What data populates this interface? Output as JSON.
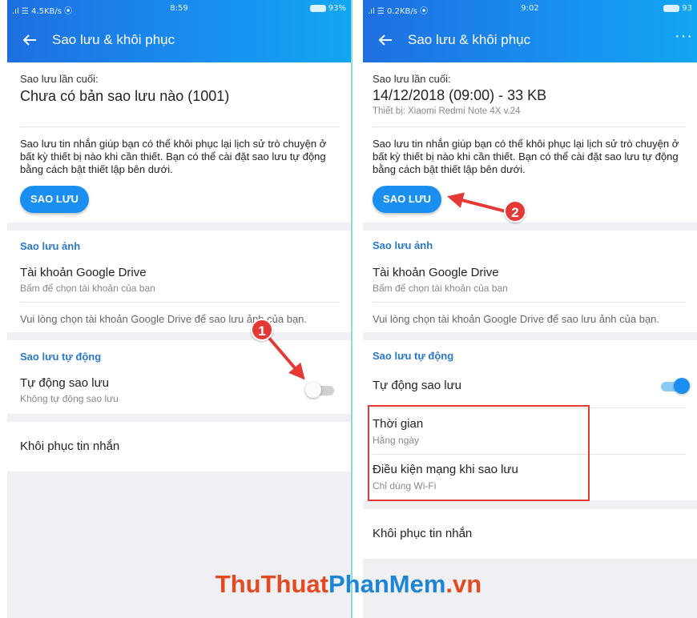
{
  "colors": {
    "accent": "#1a8ff2",
    "annotation": "#e53935"
  },
  "left": {
    "status": {
      "net": ".ıl ☰ 4.5KB/s  ⦿",
      "time": "8:59",
      "battery": "93%"
    },
    "appbar_title": "Sao lưu & khôi phục",
    "last_backup_label": "Sao lưu lần cuối:",
    "last_backup_value": "Chưa có bản sao lưu nào (1001)",
    "description": "Sao lưu tin nhắn giúp bạn có thể khôi phục lại lịch sử trò chuyện ở bất kỳ thiết bị nào khi cần thiết. Bạn có thể cài đặt sao lưu tự động bằng cách bật thiết lập bên dưới.",
    "backup_button": "SAO LƯU",
    "photo_section": "Sao lưu ảnh",
    "gdrive_title": "Tài khoản Google Drive",
    "gdrive_sub": "Bấm để chọn tài khoản của bạn",
    "gdrive_hint": "Vui lòng chọn tài khoản Google Drive để sao lưu ảnh của bạn.",
    "auto_section": "Sao lưu tự động",
    "auto_title": "Tự động sao lưu",
    "auto_sub": "Không tự động sao lưu",
    "auto_enabled": false,
    "restore": "Khôi phục tin nhắn",
    "step_badge": "1"
  },
  "right": {
    "status": {
      "net": ".ıl ☰ 0.2KB/s  ⦿",
      "time": "9:02",
      "battery": "93"
    },
    "appbar_title": "Sao lưu & khôi phục",
    "more_icon": "⋮",
    "last_backup_label": "Sao lưu lần cuối:",
    "last_backup_value": "14/12/2018 (09:00) - 33 KB",
    "device": "Thiết bị: Xiaomi Redmi Note 4X v.24",
    "description": "Sao lưu tin nhắn giúp bạn có thể khôi phục lại lịch sử trò chuyện ở bất kỳ thiết bị nào khi cần thiết. Bạn có thể cài đặt sao lưu tự động bằng cách bật thiết lập bên dưới.",
    "backup_button": "SAO LƯU",
    "photo_section": "Sao lưu ảnh",
    "gdrive_title": "Tài khoản Google Drive",
    "gdrive_sub": "Bấm để chọn tài khoản của bạn",
    "gdrive_hint": "Vui lòng chọn tài khoản Google Drive để sao lưu ảnh của bạn.",
    "auto_section": "Sao lưu tự động",
    "auto_title": "Tự động sao lưu",
    "auto_enabled": true,
    "time_title": "Thời gian",
    "time_sub": "Hằng ngày",
    "network_title": "Điều kiện mạng khi sao lưu",
    "network_sub": "Chỉ dùng Wi-Fi",
    "restore": "Khôi phục tin nhắn",
    "step_badge": "2"
  },
  "watermark": {
    "part1": "ThuThuat",
    "part2": "PhanMem",
    "part3": ".vn"
  }
}
